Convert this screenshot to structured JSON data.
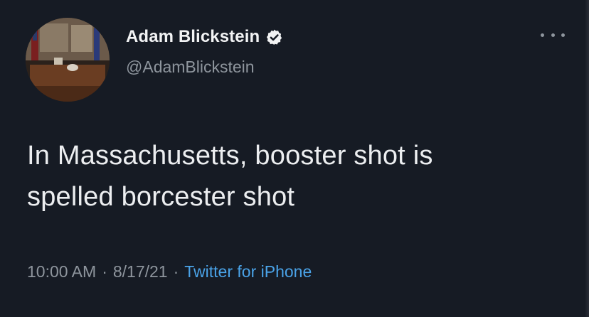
{
  "tweet": {
    "author": {
      "display_name": "Adam Blickstein",
      "handle": "@AdamBlickstein",
      "verified": true,
      "avatar_icon": "office-photo"
    },
    "text_line1": "In Massachusetts, booster shot is",
    "text_line2": "spelled borcester shot",
    "time": "10:00 AM",
    "separator": "·",
    "date": "8/17/21",
    "source": "Twitter for iPhone",
    "more_icon": "more-horizontal-icon"
  },
  "colors": {
    "background": "#161b24",
    "text": "#eceef0",
    "muted": "#8e959d",
    "link": "#4aa3e8"
  }
}
